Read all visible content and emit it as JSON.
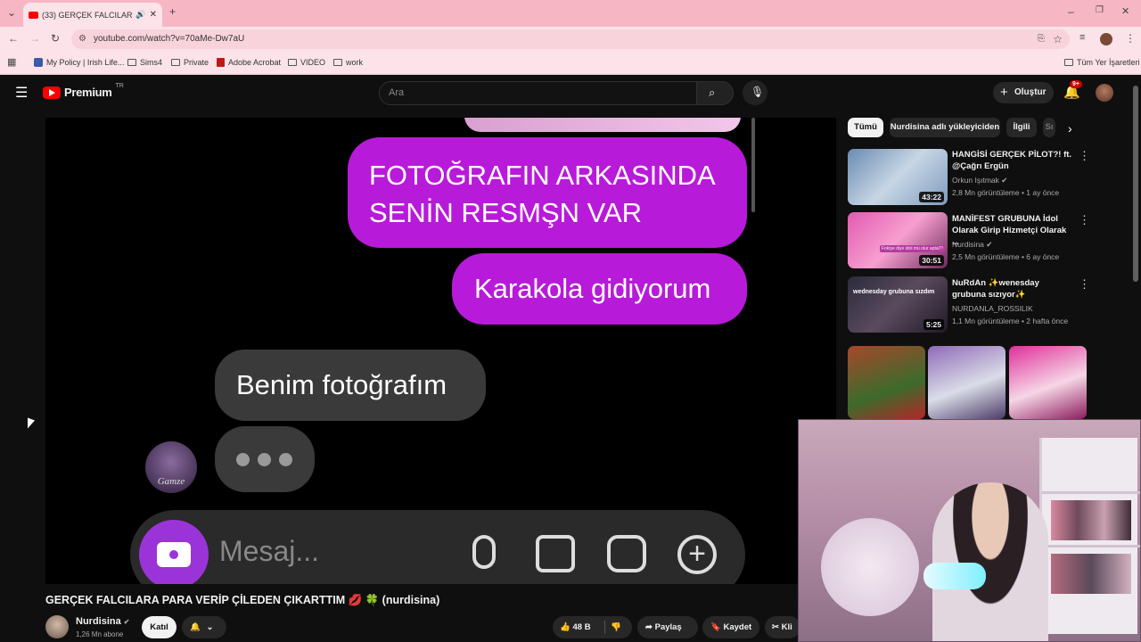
{
  "browser": {
    "tab_title": "(33) GERÇEK FALCILARA PA...",
    "url": "youtube.com/watch?v=70aMe-Dw7aU",
    "bookmarks": [
      "My Policy | Irish Life...",
      "Sims4",
      "Private",
      "Adobe Acrobat",
      "VIDEO",
      "work"
    ],
    "all_bookmarks": "Tüm Yer İşaretleri"
  },
  "youtube": {
    "logo": "Premium",
    "region": "TR",
    "search_placeholder": "Ara",
    "create_label": "Oluştur",
    "notif_count": "9+"
  },
  "video_content": {
    "bubble1_line1": "FOTOĞRAFIN ARKASINDA",
    "bubble1_line2": "SENİN RESMŞN VAR",
    "bubble2": "Karakola gidiyorum",
    "bubble3": "Benim fotoğrafım",
    "avatar_text": "Gamze",
    "message_placeholder": "Mesaj..."
  },
  "chips": [
    "Tümü",
    "Nurdisina adlı yükleyiciden",
    "İlgili",
    "Sı"
  ],
  "recommendations": [
    {
      "title": "HANGİSİ GERÇEK PİLOT?! ft. @Çağrı Ergün",
      "channel": "Orkun Işıtmak",
      "meta": "2,8 Mn görüntüleme • 1 ay önce",
      "duration": "43:22"
    },
    {
      "title": "MANİFEST GRUBUNA İdol Olarak Girip Hizmetçi Olarak ...",
      "channel": "Nurdisina",
      "meta": "2,5 Mn görüntüleme • 6 ay önce",
      "duration": "30:51",
      "thumb_text": "Fokiye diye idol mü olur aptal?!"
    },
    {
      "title": "NuRdAn ✨wenesday grubuna sızıyor✨",
      "channel": "NURDANLA_ROSSILIK",
      "meta": "1,1 Mn görüntüleme • 2 hafta önce",
      "duration": "5:25",
      "thumb_text": "wednesday grubuna sızdım"
    }
  ],
  "video": {
    "title": "GERÇEK FALCILARA PARA VERİP ÇİLEDEN ÇIKARTTIM 💋 🍀 (nurdisina)",
    "channel": "Nurdisina",
    "subscribers": "1,26 Mn abone",
    "join_label": "Katıl",
    "likes": "48 B",
    "share_label": "Paylaş",
    "save_label": "Kaydet",
    "clip_label": "Kli"
  }
}
